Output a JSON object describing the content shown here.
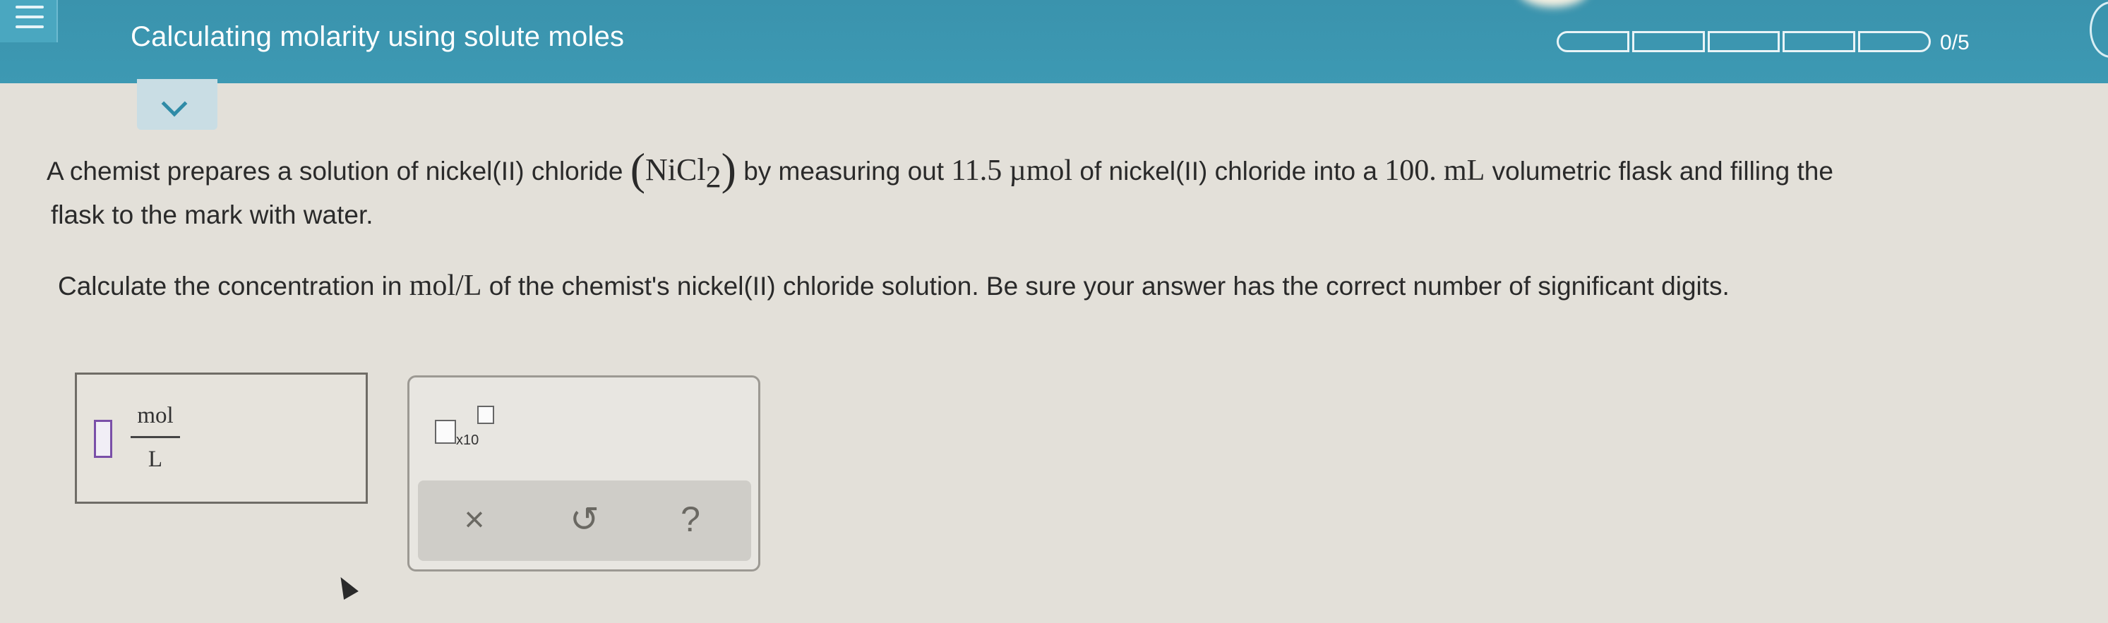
{
  "header": {
    "title": "Calculating molarity using solute moles",
    "progress": {
      "completed": 0,
      "total": 5,
      "label": "0/5"
    }
  },
  "question": {
    "line1_a": "A chemist prepares a solution of nickel(II) chloride ",
    "formula_main": "NiCl",
    "formula_sub": "2",
    "line1_b": " by measuring out ",
    "amount": "11.5",
    "amount_unit": "µmol",
    "line1_c": " of nickel(II) chloride into a ",
    "volume": "100.",
    "volume_unit": "mL",
    "line1_d": " volumetric flask and filling the",
    "line2": "flask to the mark with water.",
    "prompt_a": "Calculate the concentration in ",
    "prompt_unit": "mol/L",
    "prompt_b": " of the chemist's nickel(II) chloride solution. Be sure your answer has the correct number of significant digits."
  },
  "answer": {
    "numerator_unit": "mol",
    "denominator_unit": "L",
    "value": ""
  },
  "tools": {
    "sci_label": "x10",
    "clear_symbol": "×",
    "undo_symbol": "↺",
    "help_symbol": "?"
  }
}
